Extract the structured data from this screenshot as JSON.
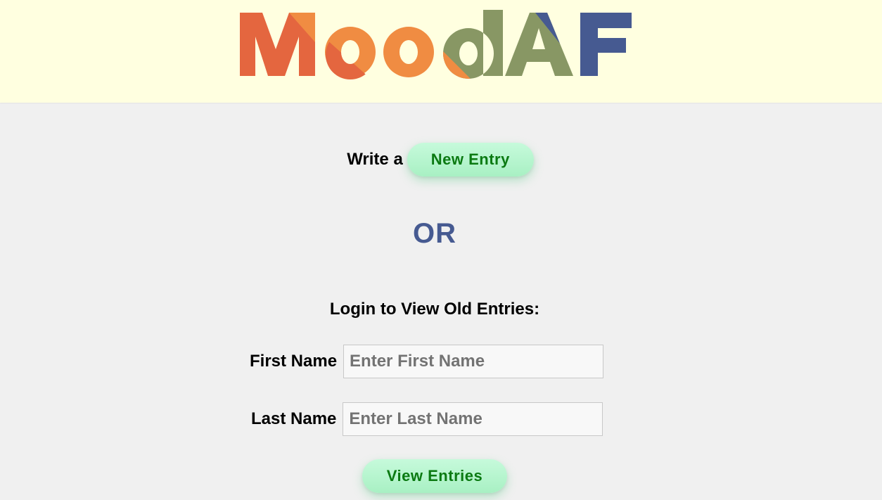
{
  "header": {
    "logo_text": "MoodAF",
    "colors": {
      "orange_dark": "#e4663f",
      "orange": "#f08c42",
      "olive": "#889764",
      "blue": "#465a91",
      "background": "#ffffe0"
    }
  },
  "main": {
    "write_label": "Write a",
    "new_entry_button": "New Entry",
    "or_text": "OR",
    "login_title": "Login to View Old Entries:",
    "first_name": {
      "label": "First Name",
      "placeholder": "Enter First Name",
      "value": ""
    },
    "last_name": {
      "label": "Last Name",
      "placeholder": "Enter Last Name",
      "value": ""
    },
    "view_entries_button": "View Entries"
  },
  "colors": {
    "page_background": "#f0f0f0",
    "button_text": "#0b7a12",
    "button_background": "#b5f5ce",
    "or_color": "#465a91"
  }
}
